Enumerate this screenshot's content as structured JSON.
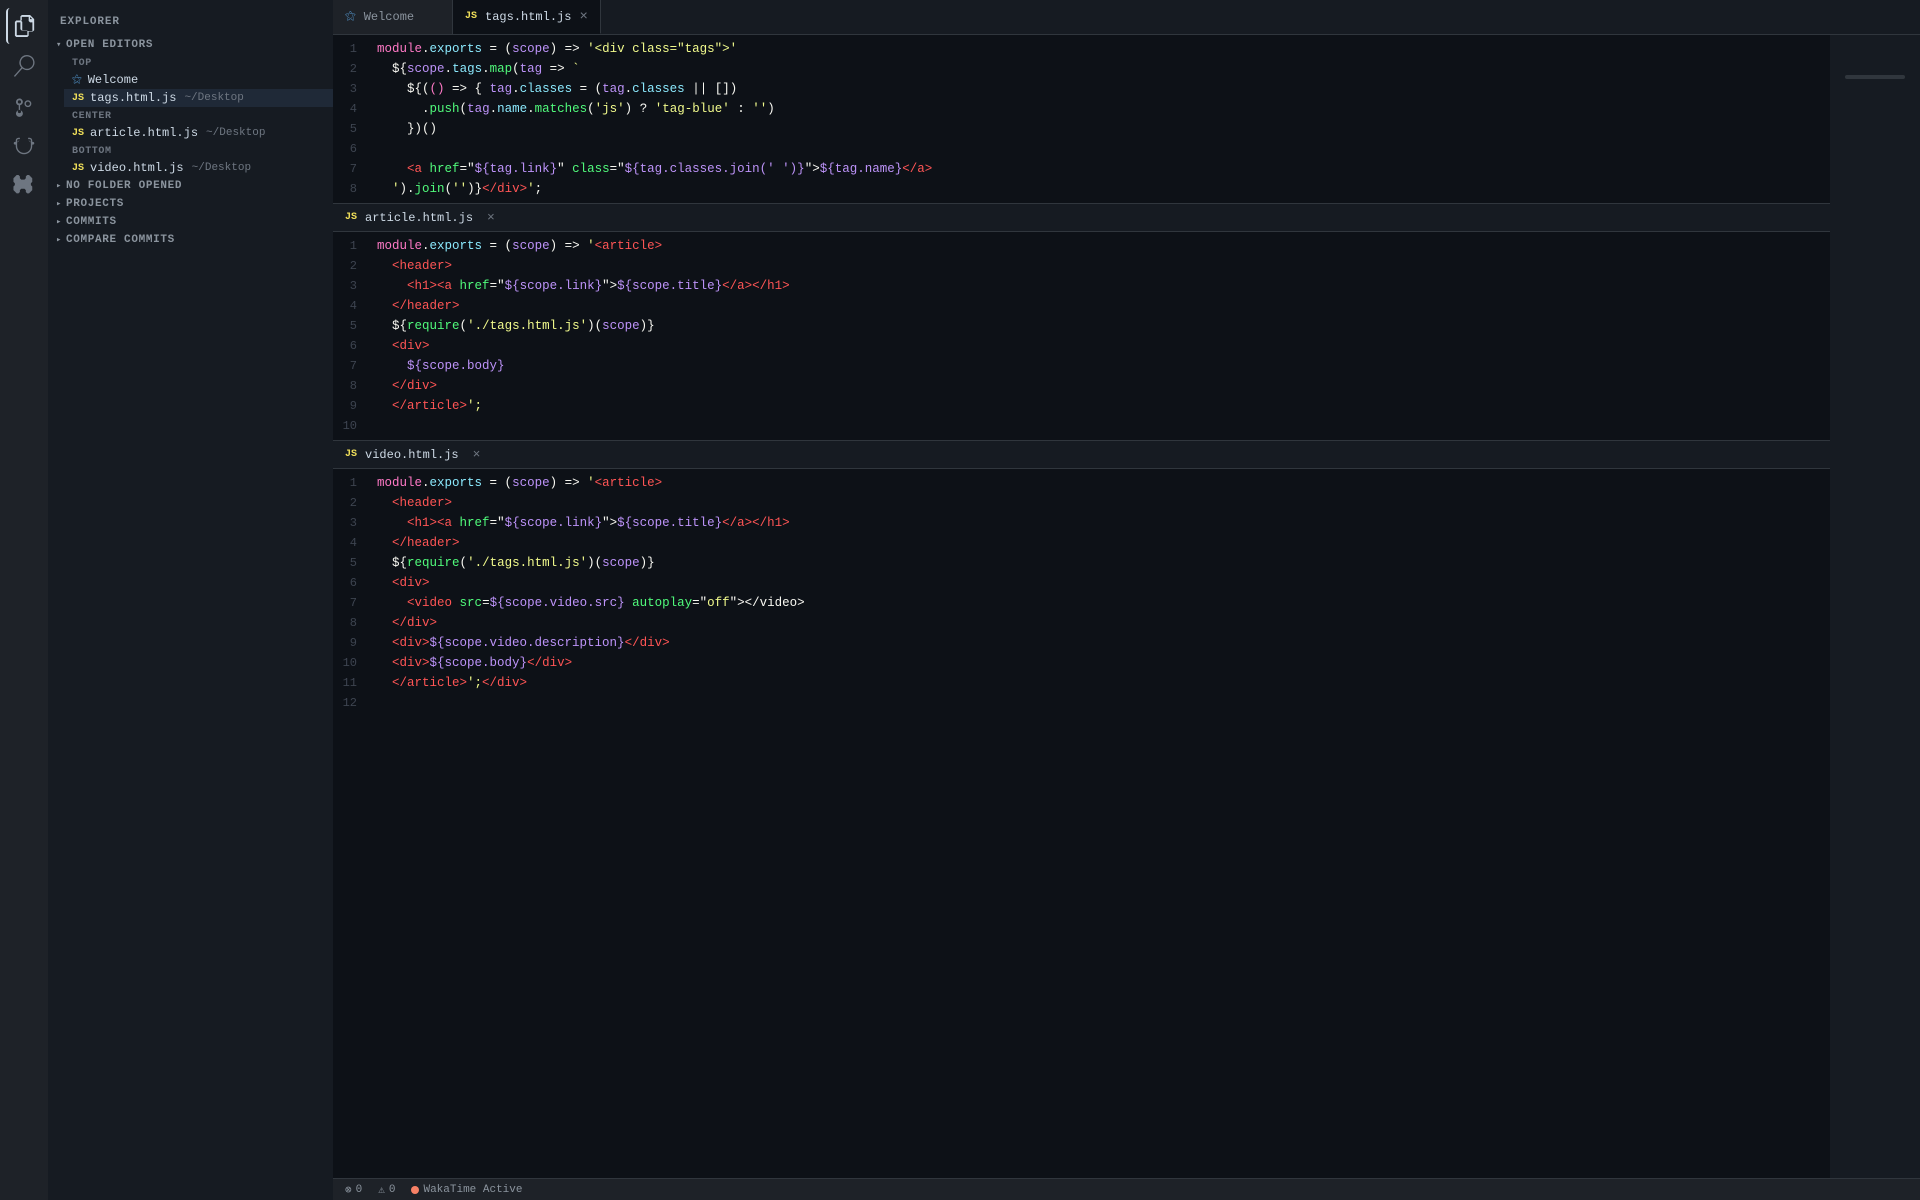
{
  "activity": {
    "icons": [
      {
        "name": "files-icon",
        "symbol": "⧉",
        "active": true
      },
      {
        "name": "search-icon",
        "symbol": "🔍",
        "active": false
      },
      {
        "name": "source-control-icon",
        "symbol": "⑂",
        "active": false
      },
      {
        "name": "debug-icon",
        "symbol": "▷",
        "active": false
      },
      {
        "name": "extensions-icon",
        "symbol": "⊞",
        "active": false
      }
    ]
  },
  "sidebar": {
    "title": "EXPLORER",
    "sections": [
      {
        "name": "open-editors",
        "label": "OPEN EDITORS",
        "expanded": true,
        "subsections": [
          {
            "name": "top",
            "label": "TOP",
            "files": [
              {
                "name": "Welcome",
                "icon": "vscode",
                "path": ""
              },
              {
                "name": "tags.html.js",
                "icon": "js",
                "path": "~/Desktop",
                "active": true
              }
            ]
          },
          {
            "name": "center",
            "label": "CENTER",
            "files": [
              {
                "name": "article.html.js",
                "icon": "js",
                "path": "~/Desktop"
              }
            ]
          },
          {
            "name": "bottom",
            "label": "BOTTOM",
            "files": [
              {
                "name": "video.html.js",
                "icon": "js",
                "path": "~/Desktop"
              }
            ]
          }
        ]
      },
      {
        "name": "no-folder",
        "label": "NO FOLDER OPENED",
        "expanded": false
      },
      {
        "name": "projects",
        "label": "PROJECTS",
        "expanded": false
      },
      {
        "name": "commits",
        "label": "COMMITS",
        "expanded": false
      },
      {
        "name": "compare-commits",
        "label": "COMPARE COMMITS",
        "expanded": false
      }
    ]
  },
  "tabs": [
    {
      "name": "Welcome",
      "icon": "vscode",
      "active": false,
      "closable": false
    },
    {
      "name": "tags.html.js",
      "icon": "js",
      "active": true,
      "closable": true
    }
  ],
  "code_sections": [
    {
      "file": "tags.html.js",
      "icon": "js",
      "closable": true,
      "lines": [
        {
          "num": 1,
          "content": "module.exports = (scope) => '<div class=\"tags\">"
        },
        {
          "num": 2,
          "content": "  ${scope.tags.map(tag => `"
        },
        {
          "num": 3,
          "content": "    ${(() => { tag.classes = (tag.classes || [])"
        },
        {
          "num": 4,
          "content": "      .push(tag.name.matches('js') ? 'tag-blue' : '')"
        },
        {
          "num": 5,
          "content": "    })()"
        },
        {
          "num": 6,
          "content": ""
        },
        {
          "num": 7,
          "content": "    <a href=\"${tag.link}\" class=\"${tag.classes.join(' ')}\">${tag.name}</a>"
        },
        {
          "num": 8,
          "content": "  ').join('')}</div>';"
        }
      ]
    },
    {
      "file": "article.html.js",
      "icon": "js",
      "closable": true,
      "lines": [
        {
          "num": 1,
          "content": "module.exports = (scope) => '<article>"
        },
        {
          "num": 2,
          "content": "  <header>"
        },
        {
          "num": 3,
          "content": "    <h1><a href=\"${scope.link}\">${scope.title}</a></h1>"
        },
        {
          "num": 4,
          "content": "  </header>"
        },
        {
          "num": 5,
          "content": "  ${require('./tags.html.js')(scope)}"
        },
        {
          "num": 6,
          "content": "  <div>"
        },
        {
          "num": 7,
          "content": "    ${scope.body}"
        },
        {
          "num": 8,
          "content": "  </div>"
        },
        {
          "num": 9,
          "content": "  </article>';"
        },
        {
          "num": 10,
          "content": ""
        }
      ]
    },
    {
      "file": "video.html.js",
      "icon": "js",
      "closable": true,
      "lines": [
        {
          "num": 1,
          "content": "module.exports = (scope) => '<article>"
        },
        {
          "num": 2,
          "content": "  <header>"
        },
        {
          "num": 3,
          "content": "    <h1><a href=\"${scope.link}\">${scope.title}</a></h1>"
        },
        {
          "num": 4,
          "content": "  </header>"
        },
        {
          "num": 5,
          "content": "  ${require('./tags.html.js')(scope)}"
        },
        {
          "num": 6,
          "content": "  <div>"
        },
        {
          "num": 7,
          "content": "    <video src=${scope.video.src} autoplay=\"off\"></video>"
        },
        {
          "num": 8,
          "content": "  </div>"
        },
        {
          "num": 9,
          "content": "  <div>${scope.video.description}</div>"
        },
        {
          "num": 10,
          "content": "  <div>${scope.body}</div>"
        },
        {
          "num": 11,
          "content": "  </article>';</div>"
        },
        {
          "num": 12,
          "content": ""
        }
      ]
    }
  ],
  "status_bar": {
    "error_count": "0",
    "warning_count": "0",
    "wakatime_label": "WakaTime Active",
    "dot_color": "#f78166"
  }
}
